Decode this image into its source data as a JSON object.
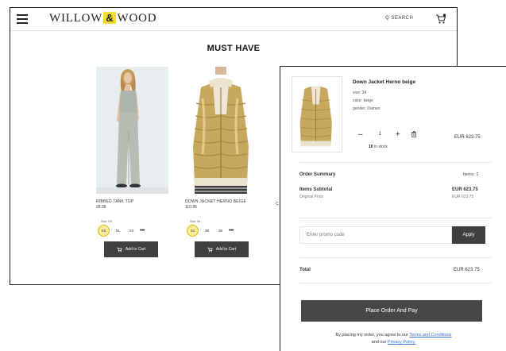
{
  "header": {
    "logo_left": "WILLOW",
    "logo_amp": "&",
    "logo_right": "WOOD",
    "search_label": "Q SEARCH"
  },
  "section_title": "MUST HAVE",
  "products": [
    {
      "name": "RIBBED TANK TOP",
      "price": "28.95",
      "size_label": "Size XS",
      "sizes": [
        "XS",
        "XL",
        "XS"
      ],
      "selected_size": "XS",
      "add_to_cart": "Add to Cart"
    },
    {
      "name": "DOWN JACKET HERNO BEIGE",
      "price": "110.95",
      "size_label": "Size 34",
      "sizes": [
        "34",
        "36",
        "38"
      ],
      "selected_size": "34",
      "add_to_cart": "Add to Cart"
    }
  ],
  "peek_letter": "C",
  "cart": {
    "item": {
      "title": "Down Jacket Herno beige",
      "size": "size: 34",
      "color": "color: beige",
      "gender": "gender: Damen",
      "quantity": "1",
      "stock_count": "10",
      "stock_suffix": "in stock",
      "price": "EUR 623.75"
    },
    "summary": {
      "title": "Order Summary",
      "items": "Items: 1",
      "subtotal_label": "Items Subtotal",
      "subtotal_value": "EUR 623.75",
      "original_label": "Original Price",
      "original_value": "EUR 623.75"
    },
    "promo_placeholder": "Enter promo code",
    "apply_label": "Apply",
    "total_label": "Total",
    "total_value": "EUR 623.75",
    "place_order_label": "Place Order And Pay",
    "terms_prefix": "By placing my order, you agree to our",
    "terms_link": "Terms and Conditions",
    "terms_middle": "and our",
    "privacy_link": "Privacy Policy."
  },
  "colors": {
    "accent_yellow": "#f5dd2a",
    "button_dark": "#3f3f3f",
    "link_blue": "#3b6fd6"
  }
}
